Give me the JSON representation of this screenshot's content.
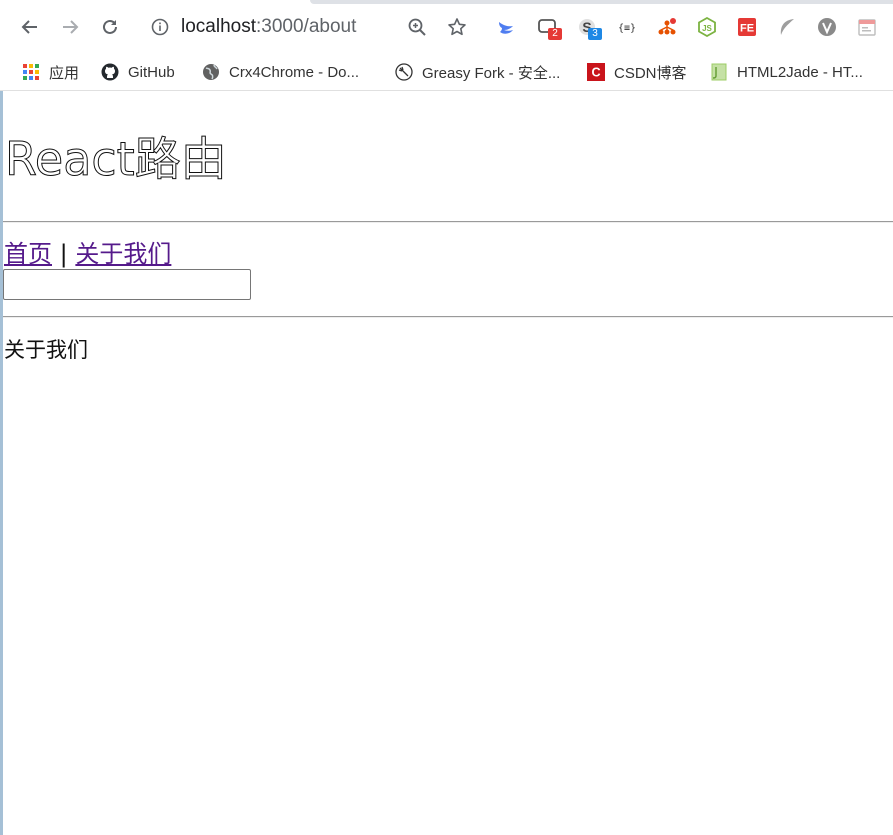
{
  "browser": {
    "url_host": "localhost",
    "url_path": ":3000/about",
    "icons": {
      "back": "arrow-left-icon",
      "forward": "arrow-right-icon",
      "reload": "reload-icon",
      "site_info": "info-icon",
      "zoom": "zoom-icon",
      "bookmark_star": "star-icon"
    },
    "extensions": [
      {
        "name": "swift-bird-icon",
        "badge": ""
      },
      {
        "name": "chat-extension-icon",
        "badge": "2",
        "badge_color": "#e53935"
      },
      {
        "name": "s-extension-icon",
        "badge": "3",
        "badge_color": "#1e88e5"
      },
      {
        "name": "json-extension-icon",
        "badge": ""
      },
      {
        "name": "network-extension-icon",
        "badge": ""
      },
      {
        "name": "nodejs-extension-icon",
        "badge": ""
      },
      {
        "name": "fe-extension-icon",
        "badge": ""
      },
      {
        "name": "leaf-extension-icon",
        "badge": ""
      },
      {
        "name": "v-extension-icon",
        "badge": ""
      },
      {
        "name": "calendar-extension-icon",
        "badge": ""
      }
    ]
  },
  "bookmarks": [
    {
      "label": "应用",
      "icon": "apps-grid-icon"
    },
    {
      "label": "GitHub",
      "icon": "github-icon"
    },
    {
      "label": "Crx4Chrome - Do...",
      "icon": "globe-icon"
    },
    {
      "label": "Greasy Fork - 安全...",
      "icon": "greasyfork-icon"
    },
    {
      "label": "CSDN博客",
      "icon": "csdn-icon"
    },
    {
      "label": "HTML2Jade - HT...",
      "icon": "html2jade-icon"
    }
  ],
  "page": {
    "title": "React路由",
    "nav": {
      "home": "首页",
      "separator": "|",
      "about": "关于我们"
    },
    "input_value": "",
    "content_text": "关于我们"
  },
  "colors": {
    "link": "#551a8b",
    "left_edge": "#5b8cb5"
  }
}
